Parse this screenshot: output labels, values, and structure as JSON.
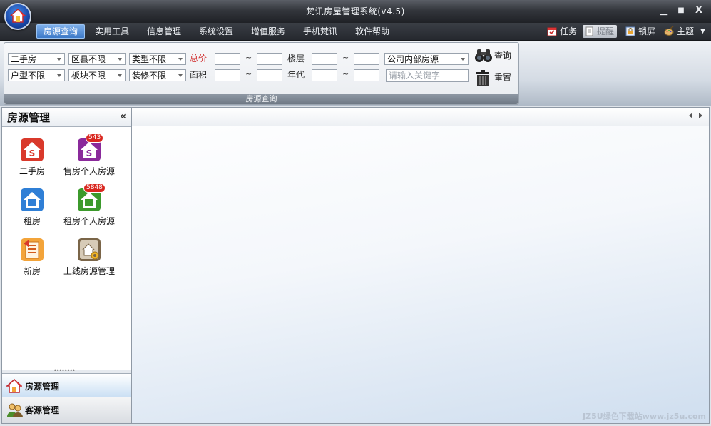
{
  "window": {
    "title": "梵讯房屋管理系统(v4.5)",
    "controls": {
      "minimize": "▁",
      "maximize": "■",
      "close": "X"
    }
  },
  "menu": {
    "items": [
      "房源查询",
      "实用工具",
      "信息管理",
      "系统设置",
      "增值服务",
      "手机梵讯",
      "软件帮助"
    ],
    "active_index": 0
  },
  "toolbar": {
    "task": "任务",
    "remind": "提醒",
    "lock": "锁屏",
    "theme": "主题",
    "dropdown": "▼"
  },
  "search": {
    "caption": "房源查询",
    "row1": {
      "type": "二手房",
      "district": "区县不限",
      "category": "类型不限",
      "price_label": "总价",
      "floor_label": "楼层",
      "source": "公司内部房源"
    },
    "row2": {
      "layout": "户型不限",
      "block": "板块不限",
      "decoration": "装修不限",
      "area_label": "面积",
      "year_label": "年代",
      "keyword_placeholder": "请输入关键字"
    },
    "range_sep": "~",
    "query_button": "查询",
    "reset_button": "重置"
  },
  "left_panel": {
    "title": "房源管理",
    "collapse": "«",
    "items": [
      {
        "label": "二手房",
        "icon": "secondhand-house-icon",
        "color": "#d9392b"
      },
      {
        "label": "售房个人房源",
        "icon": "sale-personal-house-icon",
        "color": "#8a2a9b",
        "badge": "543"
      },
      {
        "label": "租房",
        "icon": "rent-house-icon",
        "color": "#2f7fd6"
      },
      {
        "label": "租房个人房源",
        "icon": "rent-personal-house-icon",
        "color": "#3c9a2c",
        "badge": "5848"
      },
      {
        "label": "新房",
        "icon": "new-house-icon",
        "color": "#e08a2a"
      },
      {
        "label": "上线房源管理",
        "icon": "online-house-manage-icon",
        "color": "#7a6548"
      }
    ],
    "splitter_grip": "••••••••",
    "nav": [
      {
        "label": "房源管理",
        "icon": "house-icon"
      },
      {
        "label": "客源管理",
        "icon": "customers-icon"
      }
    ]
  },
  "watermark": "JZ5U绿色下载站www.jz5u.com",
  "colors": {
    "accent": "#3d79c8",
    "price_label": "#d02828",
    "badge": "#d9271f"
  }
}
